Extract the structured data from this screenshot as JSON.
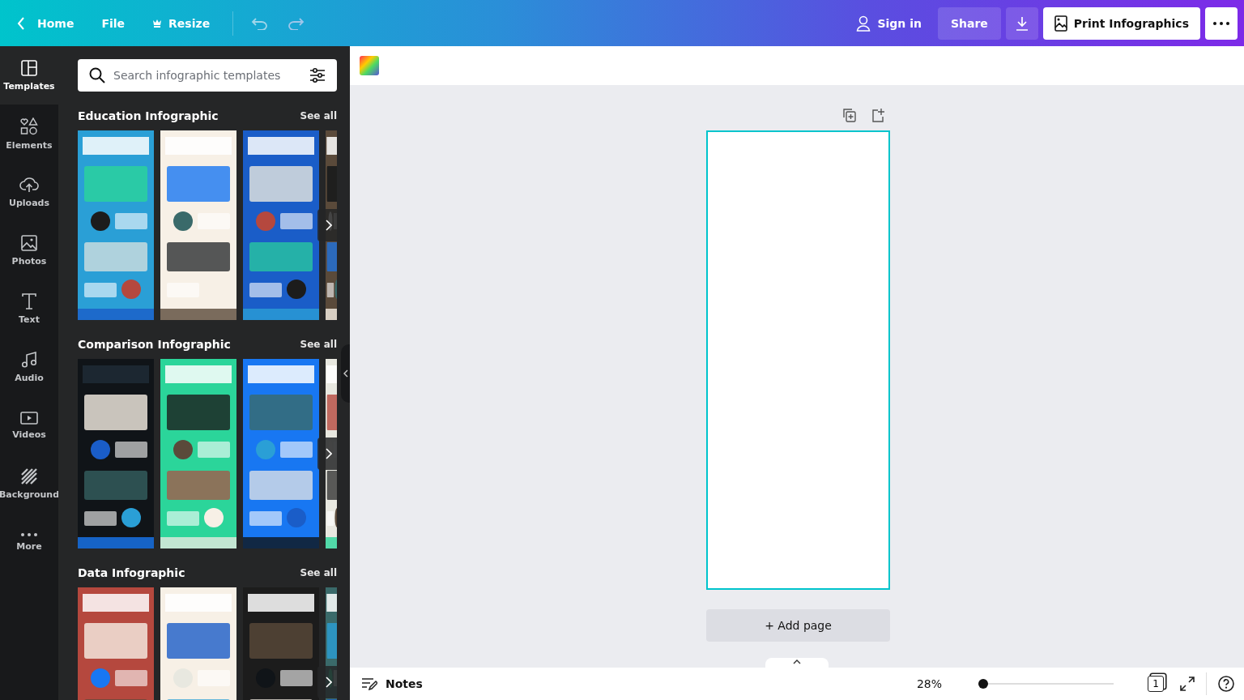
{
  "topbar": {
    "home": "Home",
    "file": "File",
    "resize": "Resize",
    "sign_in": "Sign in",
    "share": "Share",
    "print": "Print Infographics"
  },
  "sidebar": {
    "items": [
      {
        "label": "Templates",
        "selected": true
      },
      {
        "label": "Elements",
        "selected": false
      },
      {
        "label": "Uploads",
        "selected": false
      },
      {
        "label": "Photos",
        "selected": false
      },
      {
        "label": "Text",
        "selected": false
      },
      {
        "label": "Audio",
        "selected": false
      },
      {
        "label": "Videos",
        "selected": false
      },
      {
        "label": "Background",
        "selected": false
      },
      {
        "label": "More",
        "selected": false
      }
    ]
  },
  "panel": {
    "search": {
      "placeholder": "Search infographic templates"
    },
    "sections": [
      {
        "title": "Education Infographic",
        "see_all": "See all"
      },
      {
        "title": "Comparison Infographic",
        "see_all": "See all"
      },
      {
        "title": "Data Infographic",
        "see_all": "See all"
      }
    ]
  },
  "canvas": {
    "add_page": "+ Add page"
  },
  "bottom_bar": {
    "notes": "Notes",
    "zoom": "28%",
    "zoom_slider": {
      "level": 0.03
    },
    "page_count": "1"
  }
}
